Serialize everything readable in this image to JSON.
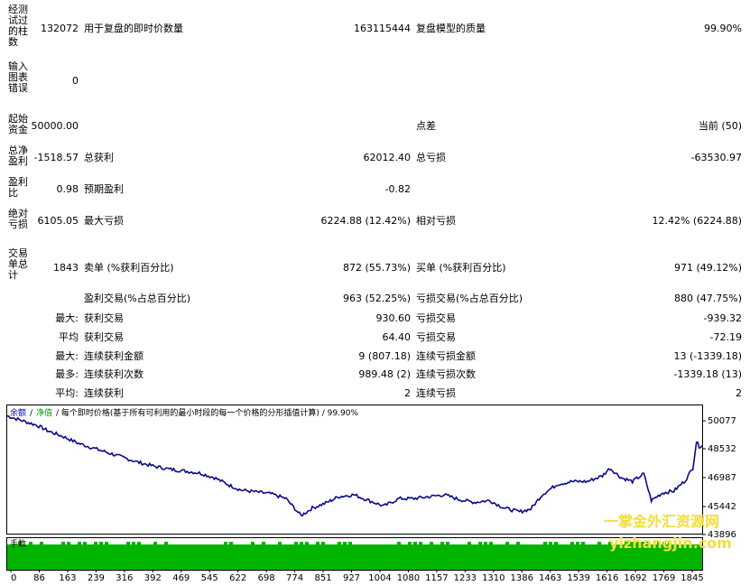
{
  "report": {
    "bars_label": "经测试过的柱数",
    "bars_value": "132072",
    "ticks_label": "用于复盘的即时价数量",
    "ticks_value": "163115444",
    "quality_label": "复盘模型的质量",
    "quality_value": "99.90%",
    "errors_label": "输入图表错误",
    "errors_value": "0",
    "deposit_label": "起始资金",
    "deposit_value": "50000.00",
    "spread_label": "点差",
    "spread_value": "当前 (50)",
    "net_label": "总净盈利",
    "net_value": "-1518.57",
    "gross_profit_label": "总获利",
    "gross_profit_value": "62012.40",
    "gross_loss_label": "总亏损",
    "gross_loss_value": "-63530.97",
    "pf_label": "盈利比",
    "pf_value": "0.98",
    "expected_label": "预期盈利",
    "expected_value": "-0.82",
    "abs_dd_label": "绝对亏损",
    "abs_dd_value": "6105.05",
    "max_dd_label": "最大亏损",
    "max_dd_value": "6224.88 (12.42%)",
    "rel_dd_label": "相对亏损",
    "rel_dd_value": "12.42% (6224.88)",
    "total_trades_label": "交易单总计",
    "total_trades_value": "1843",
    "short_label": "卖单 (%获利百分比)",
    "short_value": "872 (55.73%)",
    "long_label": "买单 (%获利百分比)",
    "long_value": "971 (49.12%)",
    "profit_trades_label": "盈利交易(%占总百分比)",
    "profit_trades_value": "963 (52.25%)",
    "loss_trades_label": "亏损交易(%占总百分比)",
    "loss_trades_value": "880 (47.75%)",
    "largest_prefix": "最大:",
    "largest_profit_label": "获利交易",
    "largest_profit_value": "930.60",
    "largest_loss_label": "亏损交易",
    "largest_loss_value": "-939.32",
    "avg_prefix": "平均",
    "avg_profit_label": "获利交易",
    "avg_profit_value": "64.40",
    "avg_loss_label": "亏损交易",
    "avg_loss_value": "-72.19",
    "max_consec_prefix": "最大:",
    "max_consec_wins_label": "连续获利金额",
    "max_consec_wins_value": "9 (807.18)",
    "max_consec_losses_label": "连续亏损金额",
    "max_consec_losses_value": "13 (-1339.18)",
    "maximal_prefix": "最多:",
    "maximal_wins_label": "连续获利次数",
    "maximal_wins_value": "989.48 (2)",
    "maximal_losses_label": "连续亏损次数",
    "maximal_losses_value": "-1339.18 (13)",
    "avg_consec_prefix": "平均:",
    "avg_consec_wins_label": "连续获利",
    "avg_consec_wins_value": "2",
    "avg_consec_losses_label": "连续亏损",
    "avg_consec_losses_value": "2"
  },
  "chart": {
    "legend_balance": "余额",
    "legend_sep1": "/",
    "legend_equity": "净值",
    "legend_rest": "/ 每个即时价格(基于所有可利用的最小时段的每一个价格的分形插值计算) / 99.90%",
    "lots_label": "手数",
    "watermark_cn": "一掌金外汇资源网",
    "watermark_url": "yizhangjin.com",
    "colors": {
      "balance": "#0a0a8a",
      "lots": "#00b400",
      "legend_balance": "#0000cc",
      "legend_equity": "#00a000"
    }
  },
  "chart_data": {
    "type": "line",
    "y_ticks": [
      "50077",
      "48532",
      "46987",
      "45442",
      "43896"
    ],
    "x_ticks": [
      "0",
      "86",
      "163",
      "239",
      "316",
      "392",
      "469",
      "545",
      "622",
      "698",
      "774",
      "851",
      "927",
      "1004",
      "1080",
      "1157",
      "1233",
      "1310",
      "1386",
      "1463",
      "1539",
      "1616",
      "1692",
      "1769",
      "1845"
    ],
    "ylim": [
      43896,
      50077
    ],
    "xlim": [
      0,
      1845
    ],
    "series": [
      {
        "x": [
          0,
          40,
          80,
          110,
          150,
          190,
          230,
          270,
          310,
          350,
          390,
          430,
          470,
          510,
          550,
          590,
          620,
          660,
          700,
          740,
          780,
          810,
          850,
          880,
          920,
          960,
          1000,
          1040,
          1080,
          1120,
          1160,
          1200,
          1240,
          1280,
          1320,
          1360,
          1390,
          1420,
          1460,
          1500,
          1540,
          1580,
          1600,
          1630,
          1660,
          1690,
          1710,
          1740,
          1770,
          1800,
          1820,
          1830,
          1837,
          1845
        ],
        "values": [
          49950,
          49700,
          49450,
          49150,
          48850,
          48500,
          48250,
          48000,
          47750,
          47500,
          47300,
          47150,
          47050,
          46950,
          46700,
          46300,
          46050,
          45950,
          45850,
          45600,
          44700,
          45100,
          45400,
          45700,
          45800,
          45500,
          45200,
          45600,
          45600,
          45700,
          45800,
          45550,
          45400,
          45500,
          45100,
          44900,
          45050,
          45800,
          46350,
          46500,
          46500,
          46800,
          47200,
          46700,
          46500,
          46900,
          45500,
          45900,
          46000,
          46550,
          47200,
          48600,
          48350,
          48400
        ]
      }
    ]
  }
}
